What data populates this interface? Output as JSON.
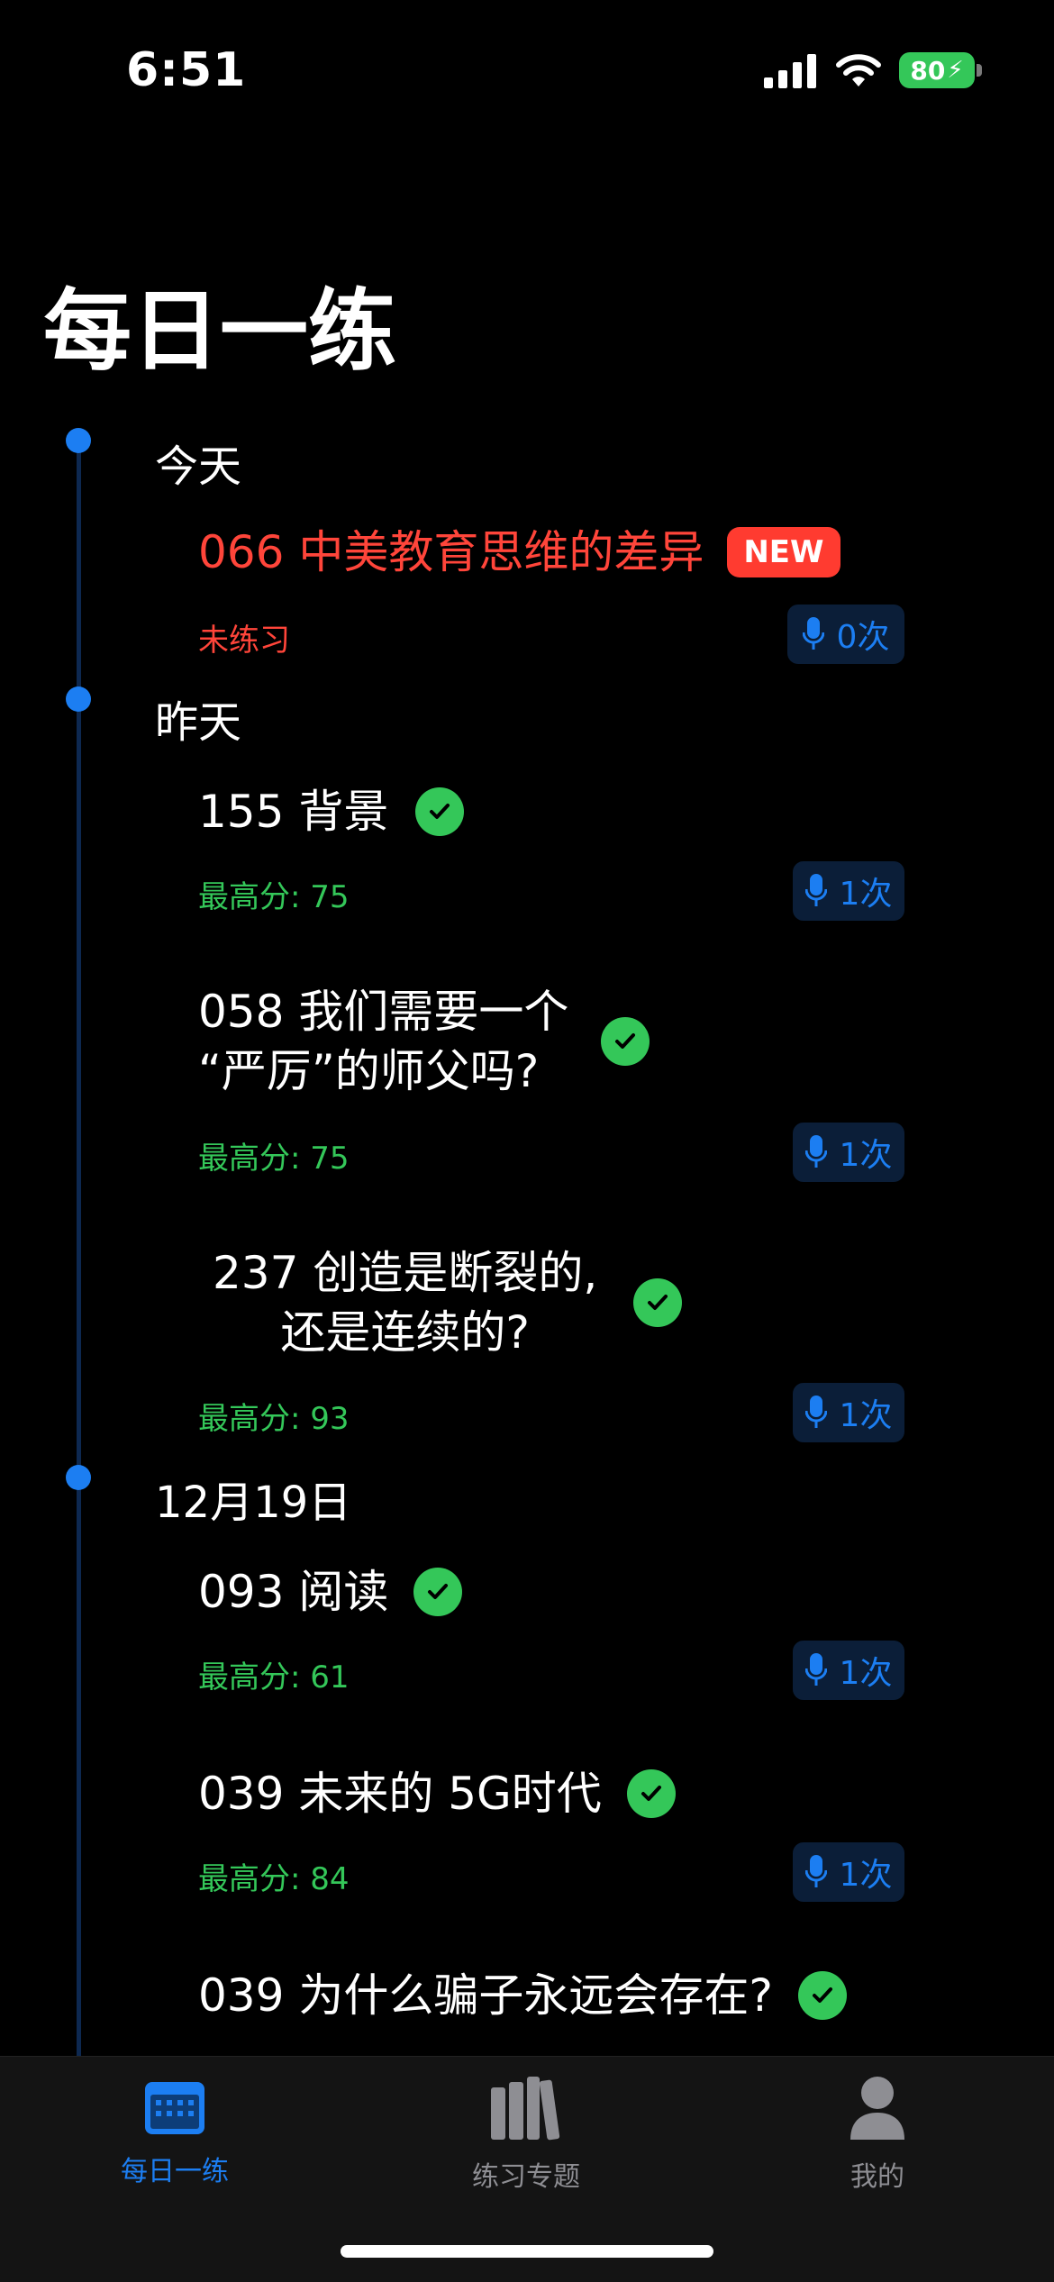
{
  "status_bar": {
    "time": "6:51",
    "battery": "80"
  },
  "page": {
    "title": "每日一练"
  },
  "groups": [
    {
      "date": "今天",
      "items": [
        {
          "title": "066 中美教育思维的差异",
          "badge": "NEW",
          "status": "未练习",
          "count": "0次"
        }
      ]
    },
    {
      "date": "昨天",
      "items": [
        {
          "title": "155 背景",
          "status": "最高分: 75",
          "count": "1次"
        },
        {
          "title_line1": "058 我们需要一个",
          "title_line2": "“严厉”的师父吗?",
          "status": "最高分: 75",
          "count": "1次"
        },
        {
          "title_line1": "237 创造是断裂的,",
          "title_line2": "还是连续的?",
          "status": "最高分: 93",
          "count": "1次"
        }
      ]
    },
    {
      "date": "12月19日",
      "items": [
        {
          "title": "093 阅读",
          "status": "最高分: 61",
          "count": "1次"
        },
        {
          "title": "039 未来的 5G时代",
          "status": "最高分: 84",
          "count": "1次"
        },
        {
          "title": "039 为什么骗子永远会存在?"
        }
      ]
    }
  ],
  "tabs": [
    {
      "label": "每日一练",
      "icon": "calendar-icon",
      "active": true
    },
    {
      "label": "练习专题",
      "icon": "books-icon",
      "active": false
    },
    {
      "label": "我的",
      "icon": "person-icon",
      "active": false
    }
  ],
  "colors": {
    "accent": "#1c7ef2",
    "success": "#34c759",
    "danger": "#ff453a",
    "background": "#000000"
  }
}
